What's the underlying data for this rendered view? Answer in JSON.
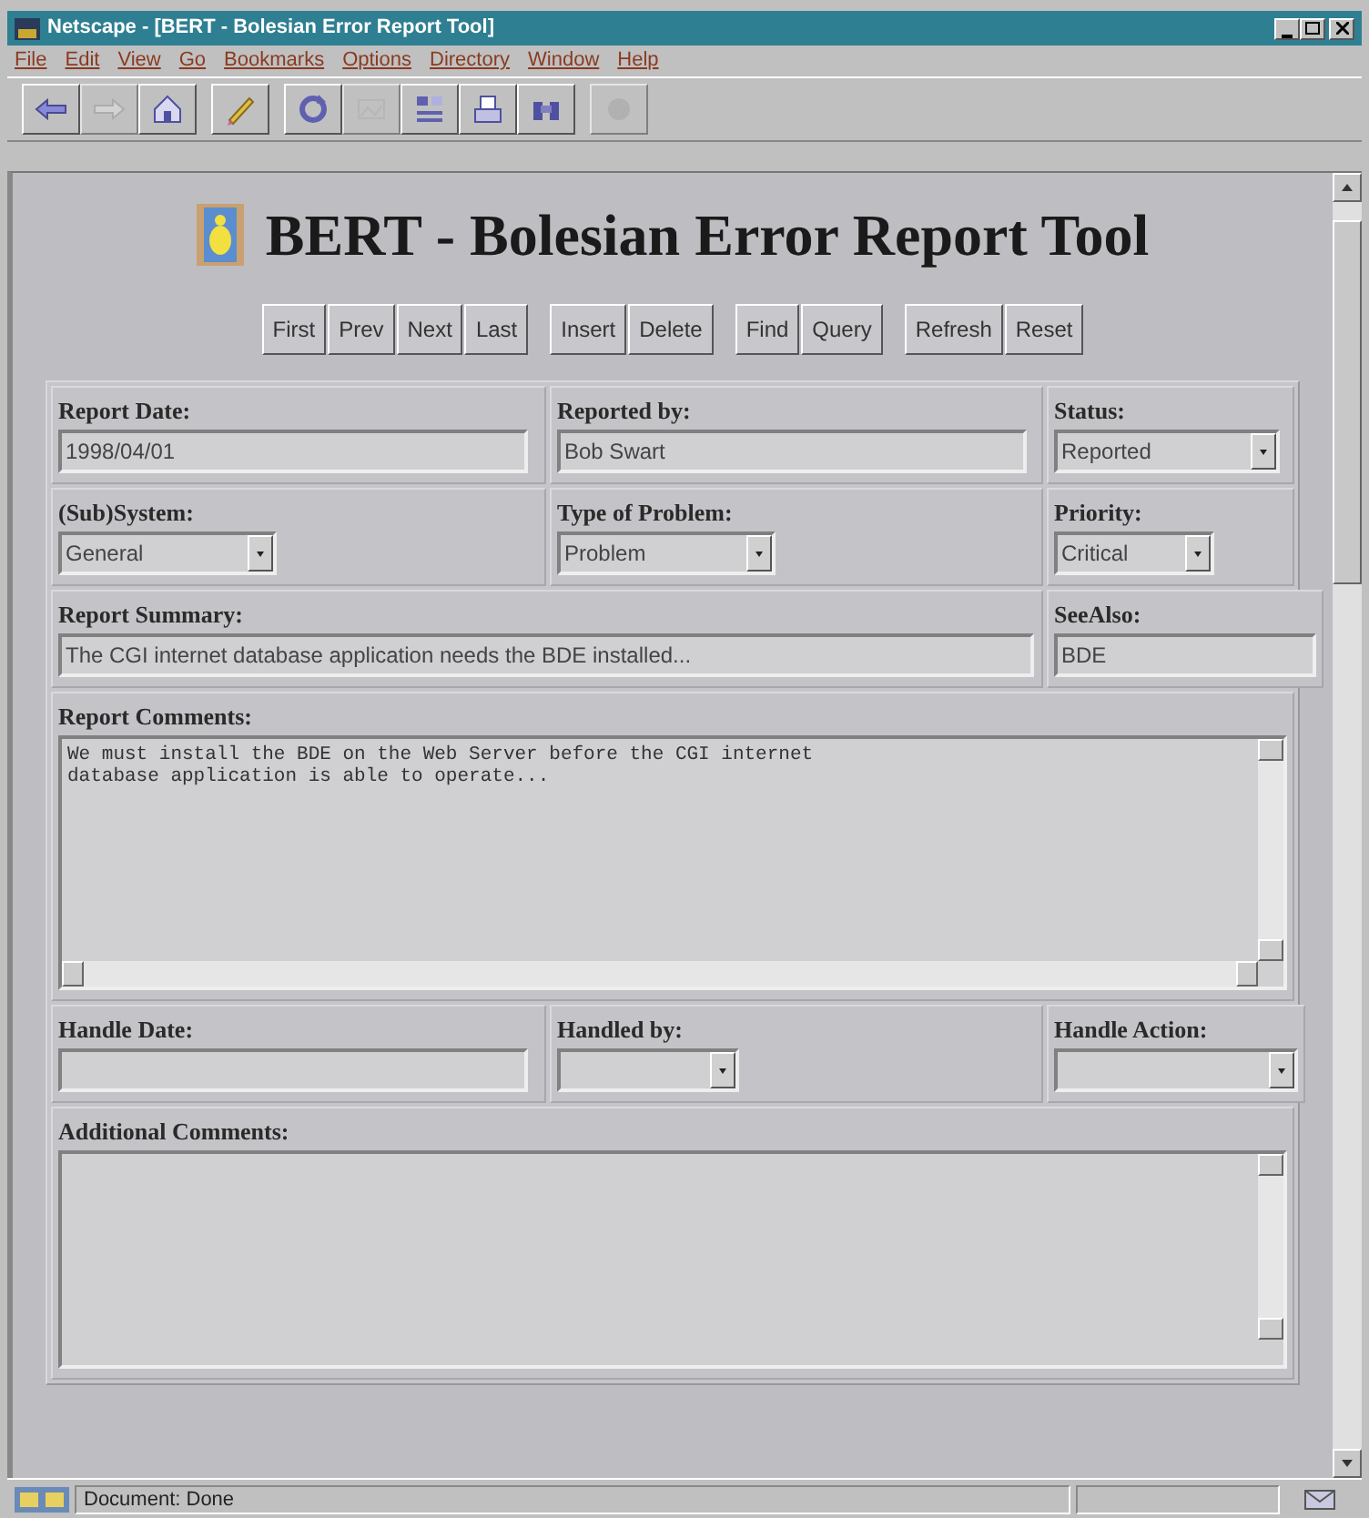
{
  "window": {
    "title": "Netscape - [BERT - Bolesian Error Report Tool]"
  },
  "menu": [
    "File",
    "Edit",
    "View",
    "Go",
    "Bookmarks",
    "Options",
    "Directory",
    "Window",
    "Help"
  ],
  "toolbar": [
    {
      "kind": "back",
      "disabled": false
    },
    {
      "kind": "forward",
      "disabled": true
    },
    {
      "kind": "home",
      "disabled": false
    },
    {
      "kind": "edit",
      "disabled": false
    },
    {
      "kind": "reload",
      "disabled": false
    },
    {
      "kind": "images",
      "disabled": true
    },
    {
      "kind": "open",
      "disabled": false
    },
    {
      "kind": "print",
      "disabled": false
    },
    {
      "kind": "find",
      "disabled": false
    },
    {
      "kind": "stop",
      "disabled": true
    }
  ],
  "page": {
    "heading": "BERT - Bolesian Error Report Tool",
    "button_groups": [
      [
        "First",
        "Prev",
        "Next",
        "Last"
      ],
      [
        "Insert",
        "Delete"
      ],
      [
        "Find",
        "Query"
      ],
      [
        "Refresh",
        "Reset"
      ]
    ],
    "form_rows": [
      [
        {
          "label": "Report Date:",
          "kind": "text",
          "value": "1998/04/01"
        },
        {
          "label": "Reported by:",
          "kind": "text",
          "value": "Bob Swart"
        },
        {
          "label": "Status:",
          "kind": "select",
          "value": "Reported"
        }
      ],
      [
        {
          "label": "(Sub)System:",
          "kind": "select",
          "value": "General"
        },
        {
          "label": "Type of Problem:",
          "kind": "select",
          "value": "Problem"
        },
        {
          "label": "Priority:",
          "kind": "select",
          "value": "Critical"
        }
      ],
      [
        {
          "label": "Report Summary:",
          "kind": "wide",
          "value": "The CGI internet database application needs the BDE installed..."
        },
        {
          "label": "SeeAlso:",
          "kind": "text",
          "value": "BDE"
        }
      ],
      [
        {
          "label": "Report Comments:",
          "kind": "area",
          "value": "We must install the BDE on the Web Server before the CGI internet\ndatabase application is able to operate..."
        }
      ],
      [
        {
          "label": "Handle Date:",
          "kind": "text"
        },
        {
          "label": "Handled by:",
          "kind": "select"
        },
        {
          "label": "Handle Action:",
          "kind": "select"
        }
      ],
      [
        {
          "label": "Additional Comments:",
          "kind": "area2"
        }
      ]
    ]
  },
  "status_bar": {
    "text": "Document: Done"
  }
}
